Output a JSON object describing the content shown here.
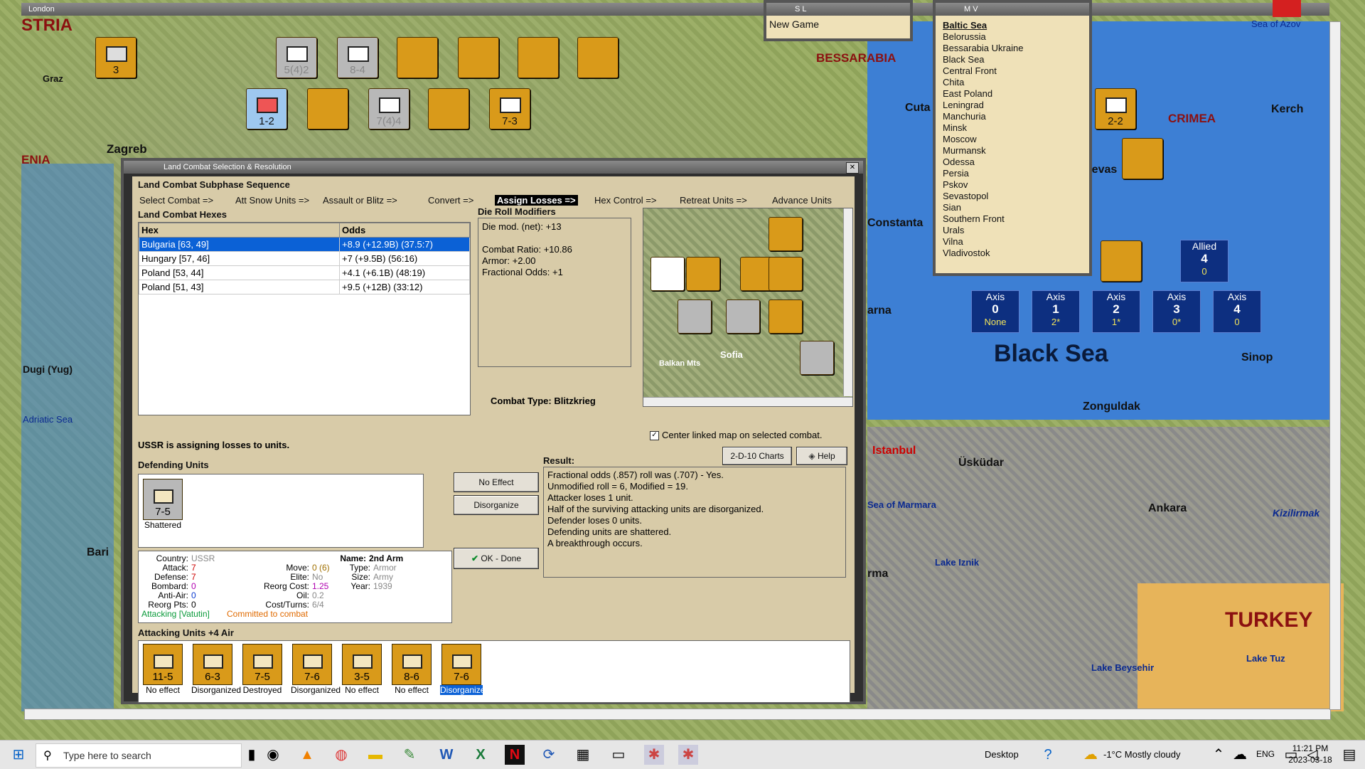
{
  "window_title": "London",
  "map": {
    "regions": [
      "BESSARABIA",
      "CRIMEA",
      "TURKEY",
      "STRIA",
      "ENIA"
    ],
    "cities": [
      "Graz",
      "Zagreb",
      "Cuta",
      "Kerch",
      "Sevas",
      "Constanta",
      "arna",
      "Sinop",
      "Zonguldak",
      "Istanbul",
      "Üsküdar",
      "Sea of Marmara",
      "Ankara",
      "Kizilirmak",
      "Lake Iznik",
      "Lake Beysehir",
      "Lake Tuz",
      "Bari",
      "Adriatic Sea",
      "Dugi (Yug)",
      "rma",
      "Sea of Azov",
      "Black Sea"
    ],
    "counters": [
      {
        "label": "5(4)2"
      },
      {
        "label": "8-4"
      },
      {
        "label": "1-2"
      },
      {
        "label": "7(4)4"
      },
      {
        "label": "7-3"
      },
      {
        "label": "2-2"
      },
      {
        "label": "3"
      }
    ]
  },
  "sl_window": {
    "title": "S L",
    "item": "New Game"
  },
  "mv_window": {
    "title": "M V",
    "items": [
      "Baltic Sea",
      "Belorussia",
      "Bessarabia Ukraine",
      "Black Sea",
      "Central Front",
      "Chita",
      "East Poland",
      "Leningrad",
      "Manchuria",
      "Minsk",
      "Moscow",
      "Murmansk",
      "Odessa",
      "Persia",
      "Pskov",
      "Sevastopol",
      "Sian",
      "Southern Front",
      "Urals",
      "Vilna",
      "Vladivostok"
    ]
  },
  "side_panels": {
    "allied": {
      "label": "Allied",
      "n": "4",
      "y": "0"
    },
    "axis": [
      {
        "label": "Axis",
        "n": "0",
        "y": "None"
      },
      {
        "label": "Axis",
        "n": "1",
        "y": "2*"
      },
      {
        "label": "Axis",
        "n": "2",
        "y": "1*"
      },
      {
        "label": "Axis",
        "n": "3",
        "y": "0*"
      },
      {
        "label": "Axis",
        "n": "4",
        "y": "0"
      }
    ]
  },
  "dialog": {
    "title": "Land Combat Selection & Resolution",
    "subphase_title": "Land Combat Subphase Sequence",
    "sequence": [
      "Select Combat =>",
      "Att Snow Units =>",
      "Assault or Blitz =>",
      "Convert =>",
      "Assign Losses =>",
      "Hex Control =>",
      "Retreat Units =>",
      "Advance Units"
    ],
    "hexes_title": "Land Combat Hexes",
    "hex_header": {
      "hex": "Hex",
      "odds": "Odds"
    },
    "hexes": [
      {
        "hex": "Bulgaria [63, 49]",
        "odds": "+8.9 (+12.9B) (37.5:7)"
      },
      {
        "hex": "Hungary [57, 46]",
        "odds": "+7 (+9.5B) (56:16)"
      },
      {
        "hex": "Poland [53, 44]",
        "odds": "+4.1 (+6.1B) (48:19)"
      },
      {
        "hex": "Poland [51, 43]",
        "odds": "+9.5 (+12B) (33:12)"
      }
    ],
    "drm_title": "Die Roll Modifiers",
    "drm_lines": [
      "Die mod. (net): +13",
      "",
      "Combat Ratio: +10.86",
      "Armor: +2.00",
      "Fractional Odds: +1"
    ],
    "combat_type": "Combat Type:  Blitzkrieg",
    "minimap": {
      "city": "Sofia",
      "mountains": "Balkan Mts"
    },
    "center_map": "Center linked map on selected combat.",
    "charts_button": "2-D-10 Charts",
    "help_button": "Help",
    "assigning_text": "USSR is assigning losses to units.",
    "defending_title": "Defending Units",
    "defender": {
      "value": "7-5",
      "status": "Shattered"
    },
    "no_effect_button": "No Effect",
    "disorganize_button": "Disorganize",
    "ok_button": "OK - Done",
    "result_title": "Result:",
    "result_lines": [
      "Fractional odds (.857) roll was (.707)  - Yes.",
      "Unmodified roll = 6, Modified = 19.",
      "Attacker loses 1 unit.",
      "Half of the surviving attacking units are disorganized.",
      "Defender loses 0 units.",
      "Defending units are shattered.",
      "A breakthrough occurs."
    ],
    "unit_info": {
      "country_label": "Country:",
      "country": "USSR",
      "name_label": "Name:",
      "name": "2nd Arm",
      "attack_label": "Attack:",
      "attack": "7",
      "move_label": "Move:",
      "move": "0 (6)",
      "type_label": "Type:",
      "type": "Armor",
      "defense_label": "Defense:",
      "defense": "7",
      "elite_label": "Elite:",
      "elite": "No",
      "size_label": "Size:",
      "size": "Army",
      "bombard_label": "Bombard:",
      "bombard": "0",
      "reorg_cost_label": "Reorg Cost:",
      "reorg_cost": "1.25",
      "year_label": "Year:",
      "year": "1939",
      "antiair_label": "Anti-Air:",
      "antiair": "0",
      "oil_label": "Oil:",
      "oil": "0.2",
      "reorg_pts_label": "Reorg Pts:",
      "reorg_pts": "0",
      "cost_turns_label": "Cost/Turns:",
      "cost_turns": "6/4",
      "attacking": "Attacking [Vatutin]",
      "committed": "Committed to combat"
    },
    "attacking_title": "Attacking Units +4 Air",
    "attackers": [
      {
        "value": "11-5",
        "status": "No effect"
      },
      {
        "value": "6-3",
        "status": "Disorganized"
      },
      {
        "value": "7-5",
        "status": "Destroyed"
      },
      {
        "value": "7-6",
        "status": "Disorganized"
      },
      {
        "value": "3-5",
        "status": "No effect"
      },
      {
        "value": "8-6",
        "status": "No effect"
      },
      {
        "value": "7-6",
        "status": "Disorganized"
      }
    ]
  },
  "taskbar": {
    "search_placeholder": "Type here to search",
    "desktop": "Desktop",
    "weather": "-1°C  Mostly cloudy",
    "lang": "ENG",
    "time": "11:21 PM",
    "date": "2023-03-18"
  }
}
